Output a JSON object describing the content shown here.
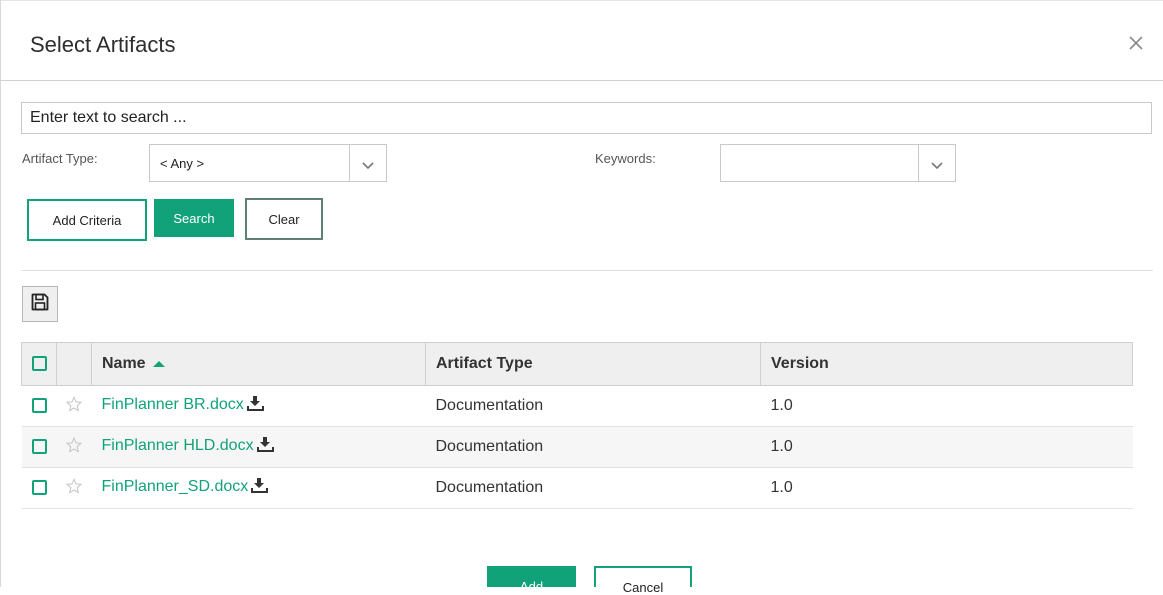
{
  "dialog": {
    "title": "Select Artifacts"
  },
  "search": {
    "placeholder": "Enter text to search ..."
  },
  "filters": {
    "artifact_type_label": "Artifact Type:",
    "artifact_type_value": "< Any >",
    "keywords_label": "Keywords:",
    "keywords_value": ""
  },
  "buttons": {
    "add_criteria": "Add Criteria",
    "search": "Search",
    "clear": "Clear",
    "add": "Add",
    "cancel": "Cancel"
  },
  "table": {
    "columns": [
      "Name",
      "Artifact Type",
      "Version"
    ],
    "sorted_column": "Name",
    "sort_direction": "ascending",
    "rows": [
      {
        "name": "FinPlanner BR.docx",
        "type": "Documentation",
        "version": "1.0"
      },
      {
        "name": "FinPlanner HLD.docx",
        "type": "Documentation",
        "version": "1.0"
      },
      {
        "name": "FinPlanner_SD.docx",
        "type": "Documentation",
        "version": "1.0"
      }
    ]
  },
  "icons": {
    "close": "close-icon",
    "dropdown": "chevron-down-icon",
    "save": "save-icon",
    "sort": "sort-ascending-icon",
    "favorite": "star-icon",
    "download": "download-icon",
    "checkbox": "checkbox-icon"
  },
  "colors": {
    "accent": "#12a279",
    "clear_border": "#5f7f74",
    "header_bg": "#efefef"
  }
}
